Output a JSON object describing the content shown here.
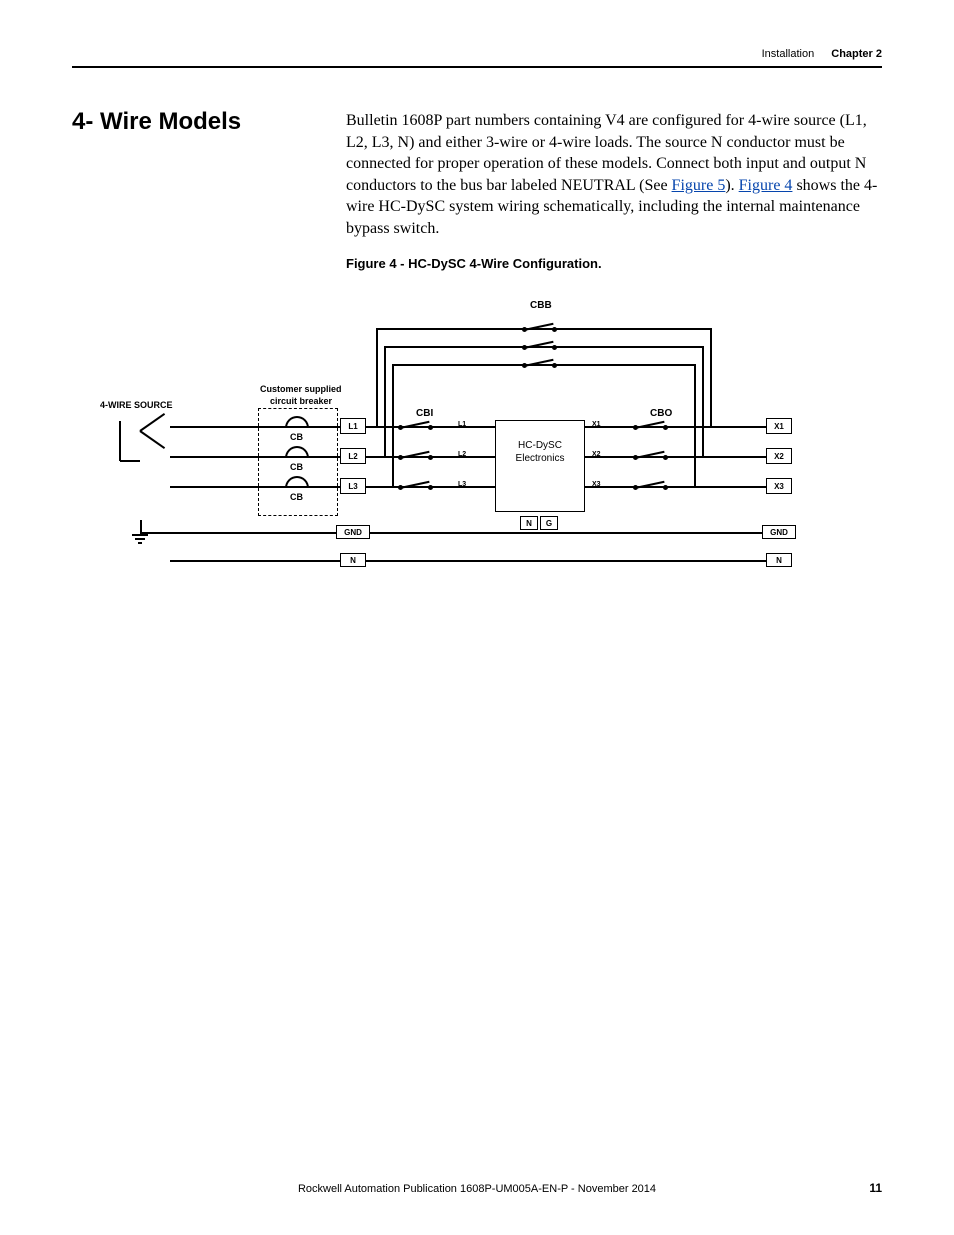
{
  "header": {
    "section": "Installation",
    "chapter": "Chapter 2"
  },
  "section_title": "4- Wire Models",
  "body": {
    "pre_link1": "Bulletin 1608P part numbers containing V4 are configured for 4-wire source (L1, L2, L3, N) and either 3-wire or 4-wire loads. The source N conductor must be connected for proper operation of these models. Connect both input and output N conductors to the bus bar labeled NEUTRAL (See ",
    "link1": "Figure 5",
    "mid": "). ",
    "link2": "Figure 4",
    "post_link2": " shows the 4-wire HC-DySC system wiring schematically, including the internal maintenance bypass switch."
  },
  "figure_caption": "Figure 4 - HC-DySC 4-Wire Configuration.",
  "diagram": {
    "labels": {
      "source": "4-WIRE SOURCE",
      "cust_breaker_l1": "Customer supplied",
      "cust_breaker_l2": "circuit breaker",
      "cbb": "CBB",
      "cbi": "CBI",
      "cbo": "CBO",
      "cb": "CB",
      "electronics_l1": "HC-DySC",
      "electronics_l2": "Electronics",
      "l1": "L1",
      "l2": "L2",
      "l3": "L3",
      "ll1": "L1",
      "ll2": "L2",
      "ll3": "L3",
      "x1": "X1",
      "x2": "X2",
      "x3": "X3",
      "xx1": "X1",
      "xx2": "X2",
      "xx3": "X3",
      "gnd": "GND",
      "gnd2": "GND",
      "n": "N",
      "n2": "N",
      "ng": "N",
      "g": "G"
    }
  },
  "footer": "Rockwell Automation Publication 1608P-UM005A-EN-P - November 2014",
  "page_number": "11"
}
